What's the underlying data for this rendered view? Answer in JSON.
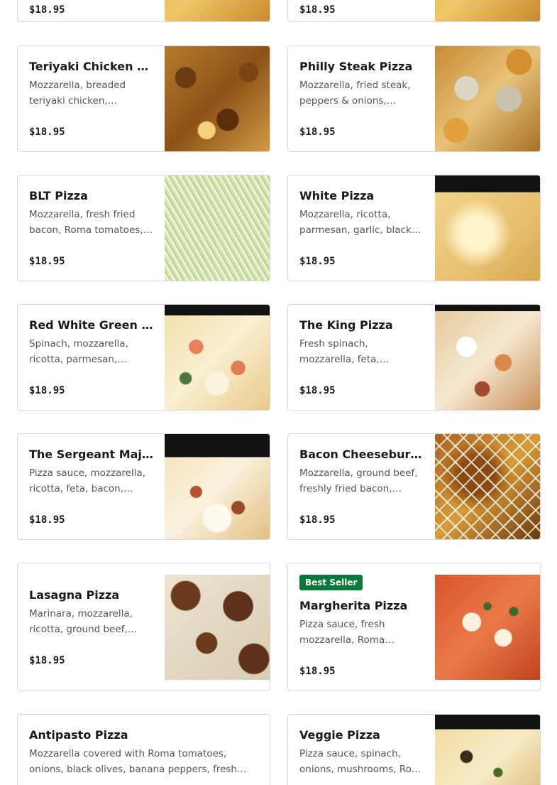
{
  "menu": {
    "items": [
      {
        "key": "top-left",
        "title": "",
        "description": "",
        "price": "$18.95",
        "badge": "",
        "photo_class": "p-cheese"
      },
      {
        "key": "top-right",
        "title": "",
        "description": "",
        "price": "$18.95",
        "badge": "",
        "photo_class": "p-cheese"
      },
      {
        "key": "teriyaki",
        "title": "Teriyaki Chicken Pizza",
        "description": "Mozzarella, breaded teriyaki chicken, onions,…",
        "price": "$18.95",
        "badge": "",
        "photo_class": "p-teriyaki"
      },
      {
        "key": "philly",
        "title": "Philly Steak Pizza",
        "description": "Mozzarella, fried steak, peppers & onions, covere…",
        "price": "$18.95",
        "badge": "",
        "photo_class": "p-philly"
      },
      {
        "key": "blt",
        "title": "BLT Pizza",
        "description": "Mozzarella, fresh fried bacon, Roma tomatoes,…",
        "price": "$18.95",
        "badge": "",
        "photo_class": "p-blt"
      },
      {
        "key": "white",
        "title": "White Pizza",
        "description": "Mozzarella, ricotta, parmesan, garlic, black…",
        "price": "$18.95",
        "badge": "",
        "photo_class": "p-white"
      },
      {
        "key": "rwg",
        "title": "Red White Green Pizza",
        "description": "Spinach, mozzarella, ricotta, parmesan, garlic,…",
        "price": "$18.95",
        "badge": "",
        "photo_class": "p-rwg"
      },
      {
        "key": "king",
        "title": "The King Pizza",
        "description": "Fresh spinach, mozzarella, feta, mushrooms, onions…",
        "price": "$18.95",
        "badge": "",
        "photo_class": "p-king"
      },
      {
        "key": "sergeant",
        "title": "The Sergeant Major…",
        "description": "Pizza sauce, mozzarella, ricotta, feta, bacon,…",
        "price": "$18.95",
        "badge": "",
        "photo_class": "p-sergeant"
      },
      {
        "key": "bacon-cheeseburger",
        "title": "Bacon Cheeseburger…",
        "description": "Mozzarella, ground beef, freshly fried bacon,…",
        "price": "$18.95",
        "badge": "",
        "photo_class": "p-bacon"
      },
      {
        "key": "lasagna",
        "title": "Lasagna Pizza",
        "description": "Marinara, mozzarella, ricotta, ground beef, Itali…",
        "price": "$18.95",
        "badge": "",
        "photo_class": "p-lasagna"
      },
      {
        "key": "margherita",
        "title": "Margherita Pizza",
        "description": "Pizza sauce, fresh mozzarella, Roma…",
        "price": "$18.95",
        "badge": "Best Seller",
        "photo_class": "p-margherita"
      },
      {
        "key": "antipasto",
        "title": "Antipasto Pizza",
        "description": "Mozzarella covered with Roma tomatoes, onions, black olives, banana peppers, fresh garlic, ham …",
        "price": "",
        "badge": "",
        "photo_class": ""
      },
      {
        "key": "veggie",
        "title": "Veggie Pizza",
        "description": "Pizza sauce, spinach, onions, mushrooms, Ro…",
        "price": "",
        "badge": "",
        "photo_class": "p-veggie"
      }
    ]
  }
}
